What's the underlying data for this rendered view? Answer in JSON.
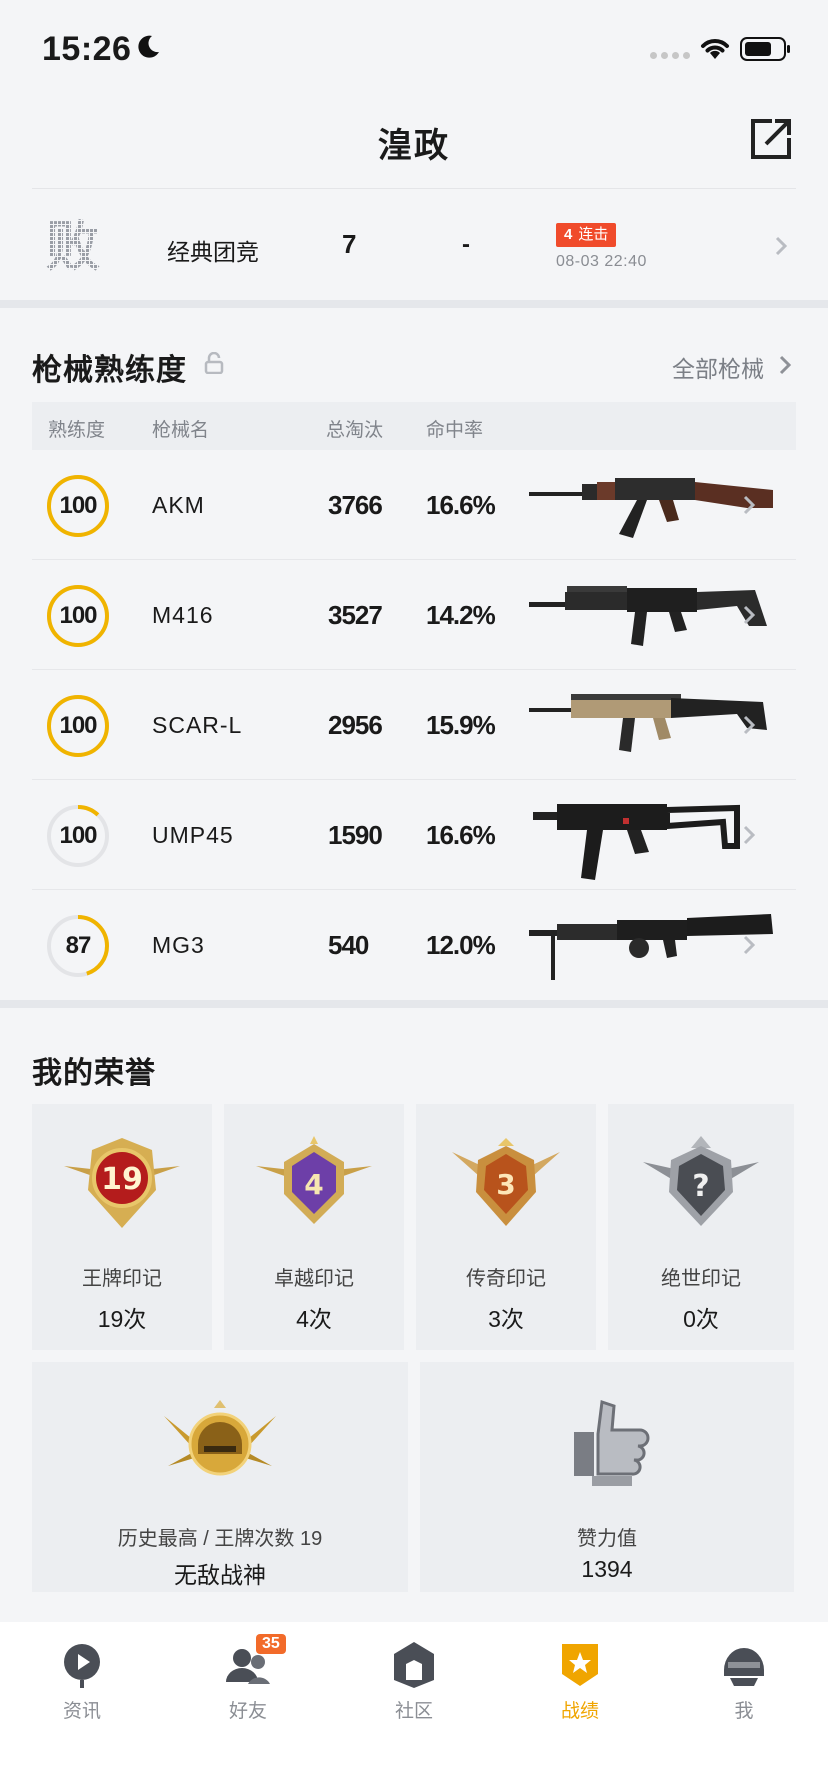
{
  "status": {
    "time": "15:26"
  },
  "header": {
    "title": "湟政"
  },
  "recent_match": {
    "result": "败",
    "mode": "经典团竞",
    "kills": "7",
    "placeholder": "-",
    "streak_count": "4",
    "streak_text": "连击",
    "time": "08-03 22:40"
  },
  "weapons": {
    "title": "枪械熟练度",
    "all_link": "全部枪械",
    "columns": [
      "熟练度",
      "枪械名",
      "总淘汰",
      "命中率"
    ],
    "rows": [
      {
        "level": "100",
        "progress": 1.0,
        "name": "AKM",
        "kills": "3766",
        "rate": "16.6%"
      },
      {
        "level": "100",
        "progress": 1.0,
        "name": "M416",
        "kills": "3527",
        "rate": "14.2%"
      },
      {
        "level": "100",
        "progress": 1.0,
        "name": "SCAR-L",
        "kills": "2956",
        "rate": "15.9%"
      },
      {
        "level": "100",
        "progress": 0.12,
        "name": "UMP45",
        "kills": "1590",
        "rate": "16.6%"
      },
      {
        "level": "87",
        "progress": 0.45,
        "name": "MG3",
        "kills": "540",
        "rate": "12.0%"
      }
    ]
  },
  "honors": {
    "title": "我的荣誉",
    "badges": [
      {
        "emblem": "19",
        "label": "王牌印记",
        "value": "19次"
      },
      {
        "emblem": "4",
        "label": "卓越印记",
        "value": "4次"
      },
      {
        "emblem": "3",
        "label": "传奇印记",
        "value": "3次"
      },
      {
        "emblem": "?",
        "label": "绝世印记",
        "value": "0次"
      }
    ],
    "highest": {
      "label": "历史最高 / 王牌次数 19",
      "value": "无敌战神"
    },
    "likes": {
      "label": "赞力值",
      "value": "1394"
    }
  },
  "tabs": [
    {
      "label": "资讯"
    },
    {
      "label": "好友",
      "badge": "35"
    },
    {
      "label": "社区"
    },
    {
      "label": "战绩"
    },
    {
      "label": "我"
    }
  ],
  "colors": {
    "accent": "#f0b400",
    "streak": "#f04b2b",
    "active_tab": "#f0a500"
  }
}
